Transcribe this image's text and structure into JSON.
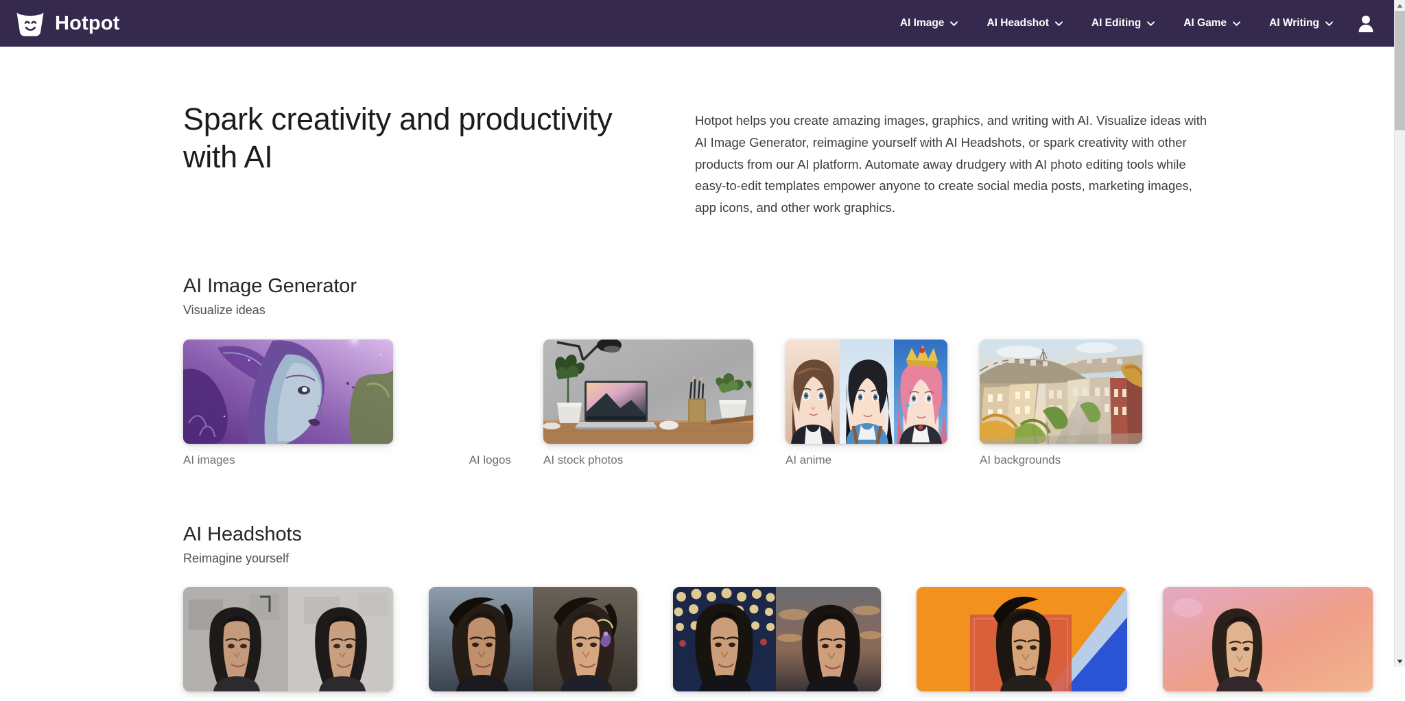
{
  "header": {
    "brand_name": "Hotpot",
    "logo_icon": "hotpot-smiley-pot-icon",
    "background_color": "#352a4d",
    "nav_items": [
      {
        "label": "AI Image",
        "icon": "chevron-down-icon"
      },
      {
        "label": "AI Headshot",
        "icon": "chevron-down-icon"
      },
      {
        "label": "AI Editing",
        "icon": "chevron-down-icon"
      },
      {
        "label": "AI Game",
        "icon": "chevron-down-icon"
      },
      {
        "label": "AI Writing",
        "icon": "chevron-down-icon"
      }
    ],
    "account_icon": "user-avatar-icon"
  },
  "hero": {
    "heading": "Spark creativity and productivity with AI",
    "paragraph": "Hotpot helps you create amazing images, graphics, and writing with AI. Visualize ideas with AI Image Generator, reimagine yourself with AI Headshots, or spark creativity with other products from our AI platform. Automate away drudgery with AI photo editing tools while easy-to-edit templates empower anyone to create social media posts, marketing images, app icons, and other work graphics."
  },
  "sections": [
    {
      "title": "AI Image Generator",
      "subtitle": "Visualize ideas",
      "cards": [
        {
          "label": "AI images",
          "art": "fantasy-elf-portrait",
          "label_align": "left"
        },
        {
          "label": "AI logos",
          "art": "none",
          "label_align": "right"
        },
        {
          "label": "AI stock photos",
          "art": "desk-laptop-photo",
          "label_align": "left"
        },
        {
          "label": "AI anime",
          "art": "anime-girls-triptych",
          "label_align": "left"
        },
        {
          "label": "AI backgrounds",
          "art": "city-hill-painting",
          "label_align": "left"
        }
      ]
    },
    {
      "title": "AI Headshots",
      "subtitle": "Reimagine yourself",
      "cards": [
        {
          "label": "",
          "art": "headshot-office-pair",
          "label_align": "left"
        },
        {
          "label": "",
          "art": "headshot-dark-hair-pair",
          "label_align": "left"
        },
        {
          "label": "",
          "art": "headshot-bokeh-pair",
          "label_align": "left"
        },
        {
          "label": "",
          "art": "headshot-orange-graphic",
          "label_align": "left"
        },
        {
          "label": "",
          "art": "headshot-pink-portrait",
          "label_align": "left"
        }
      ]
    }
  ],
  "scrollbar": {
    "up_icon": "scroll-up-arrow-icon",
    "down_icon": "scroll-down-arrow-icon",
    "thumb_position_pct": 0,
    "thumb_size_pct": 19
  }
}
